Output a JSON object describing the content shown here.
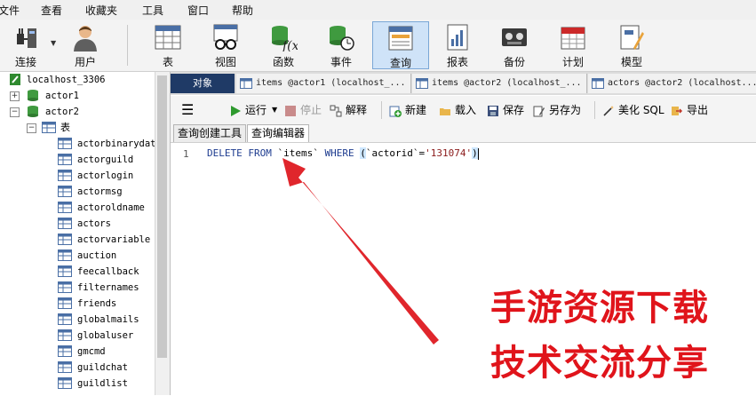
{
  "menu": [
    "文件",
    "查看",
    "收藏夹",
    "工具",
    "窗口",
    "帮助"
  ],
  "toolbar": {
    "items": [
      {
        "label": "连接",
        "icon": "plug-icon"
      },
      {
        "label": "用户",
        "icon": "user-icon"
      },
      {
        "label": "表",
        "icon": "table-icon"
      },
      {
        "label": "视图",
        "icon": "view-glasses-icon"
      },
      {
        "label": "函数",
        "icon": "function-icon"
      },
      {
        "label": "事件",
        "icon": "event-clock-icon"
      },
      {
        "label": "查询",
        "icon": "query-icon"
      },
      {
        "label": "报表",
        "icon": "report-icon"
      },
      {
        "label": "备份",
        "icon": "backup-tape-icon"
      },
      {
        "label": "计划",
        "icon": "calendar-icon"
      },
      {
        "label": "模型",
        "icon": "model-icon"
      }
    ]
  },
  "tree": {
    "connection": "localhost_3306",
    "db1": "actor1",
    "db2": "actor2",
    "tables_label": "表",
    "tables": [
      "actorbinarydata",
      "actorguild",
      "actorlogin",
      "actormsg",
      "actoroldname",
      "actors",
      "actorvariable",
      "auction",
      "feecallback",
      "filternames",
      "friends",
      "globalmails",
      "globaluser",
      "gmcmd",
      "guildchat",
      "guildlist"
    ]
  },
  "tabs": {
    "objects": "对象",
    "query_tabs": [
      "items @actor1 (localhost_...",
      "items @actor2 (localhost_...",
      "actors @actor2 (localhost..."
    ]
  },
  "query_toolbar": {
    "run": "运行",
    "stop": "停止",
    "explain": "解释",
    "new": "新建",
    "load": "载入",
    "save": "保存",
    "save_as": "另存为",
    "beautify": "美化 SQL",
    "export": "导出"
  },
  "subtabs": {
    "builder": "查询创建工具",
    "editor": "查询编辑器"
  },
  "editor": {
    "line_number": "1",
    "code": {
      "k1": "DELETE",
      "k2": "FROM",
      "table": "`items`",
      "k3": "WHERE",
      "paren_open": "(",
      "col": "`actorid`",
      "eq": "=",
      "value": "'131074'",
      "paren_close": ")"
    }
  },
  "watermark": {
    "line1": "手游资源下载",
    "line2": "技术交流分享"
  },
  "colors": {
    "accent": "#1f3a66",
    "arrow": "#e0262c",
    "watermark": "#e0141b",
    "active_toolbar": "#cfe3f8"
  }
}
